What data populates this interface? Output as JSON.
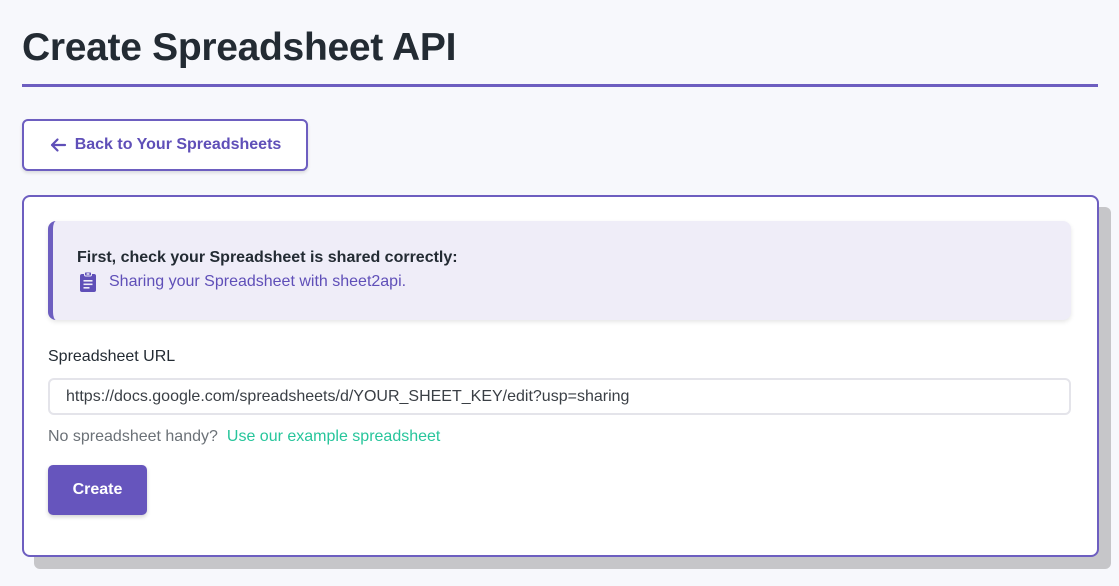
{
  "page": {
    "title": "Create Spreadsheet API"
  },
  "back_button": {
    "label": "Back to Your Spreadsheets",
    "icon": "arrow-left-icon"
  },
  "notice": {
    "heading": "First, check your Spreadsheet is shared correctly:",
    "link_label": "Sharing your Spreadsheet with sheet2api.",
    "icon": "clipboard-icon"
  },
  "form": {
    "url_label": "Spreadsheet URL",
    "url_value": "https://docs.google.com/spreadsheets/d/YOUR_SHEET_KEY/edit?usp=sharing",
    "helper_text": "No spreadsheet handy?",
    "helper_link": "Use our example spreadsheet",
    "submit_label": "Create"
  },
  "colors": {
    "accent": "#6d5ec0",
    "link_purple": "#5f4fb8",
    "link_green": "#27c59b",
    "button_bg": "#6655bd",
    "notice_bg": "#efedf8"
  }
}
